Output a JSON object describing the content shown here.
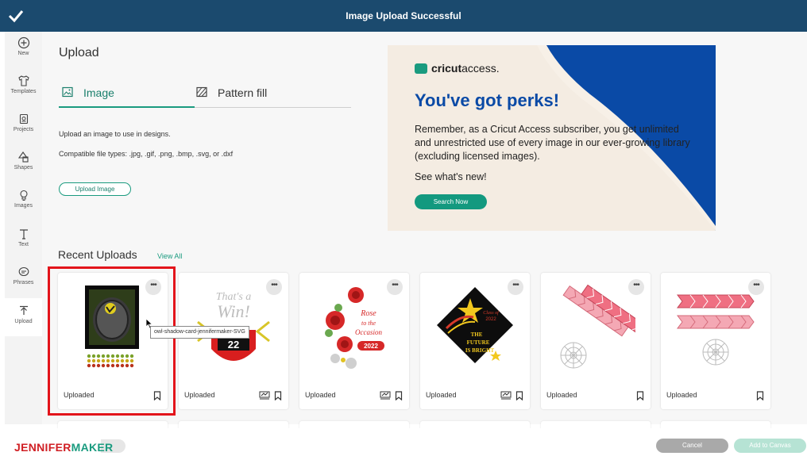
{
  "header": {
    "title": "Image Upload Successful",
    "check_icon": "checkmark-icon"
  },
  "sidebar": {
    "items": [
      {
        "label": "New",
        "icon": "plus-circle-icon"
      },
      {
        "label": "Templates",
        "icon": "tshirt-icon"
      },
      {
        "label": "Projects",
        "icon": "project-icon"
      },
      {
        "label": "Shapes",
        "icon": "shapes-icon"
      },
      {
        "label": "Images",
        "icon": "lightbulb-icon"
      },
      {
        "label": "Text",
        "icon": "text-icon"
      },
      {
        "label": "Phrases",
        "icon": "speech-bubble-icon"
      },
      {
        "label": "Upload",
        "icon": "upload-icon",
        "active": true
      }
    ]
  },
  "upload": {
    "title": "Upload",
    "tabs": [
      {
        "label": "Image",
        "active": true
      },
      {
        "label": "Pattern fill",
        "active": false
      }
    ],
    "description": "Upload an image to use in designs.",
    "file_types": "Compatible file types: .jpg, .gif, .png, .bmp, .svg, or .dxf",
    "button": "Upload Image"
  },
  "banner": {
    "brand_bold": "cricut",
    "brand_light": "access.",
    "headline": "You've got perks!",
    "body": "Remember, as a Cricut Access subscriber, you get unlimited and unrestricted use of every image in our ever-growing library (excluding licensed images).",
    "whats_new": "See what's new!",
    "button": "Search Now"
  },
  "recent": {
    "title": "Recent Uploads",
    "view_all": "View All",
    "more_label": "•••",
    "cards": [
      {
        "label": "Uploaded",
        "has_mat_icon": false,
        "artwork": "owl shadow card"
      },
      {
        "label": "Uploaded",
        "has_mat_icon": true,
        "artwork": "That's a Win 22 pennant"
      },
      {
        "label": "Uploaded",
        "has_mat_icon": true,
        "artwork": "Rose to the Occasion 2022 roses"
      },
      {
        "label": "Uploaded",
        "has_mat_icon": true,
        "artwork": "The Future is Bright graduation cap"
      },
      {
        "label": "Uploaded",
        "has_mat_icon": false,
        "artwork": "pink chevron strips light"
      },
      {
        "label": "Uploaded",
        "has_mat_icon": false,
        "artwork": "pink chevron strips"
      }
    ]
  },
  "tooltip": "owl-shadow-card-jennifermaker-SVG",
  "footer": {
    "brand_part1": "JENNIFER",
    "brand_part2": "MAKER",
    "cancel": "Cancel",
    "add_to_canvas": "Add to Canvas"
  },
  "colors": {
    "header": "#1b4a6e",
    "accent": "#1a9b7f",
    "perks_blue": "#0a4aa6",
    "highlight_red": "#e3141b"
  }
}
